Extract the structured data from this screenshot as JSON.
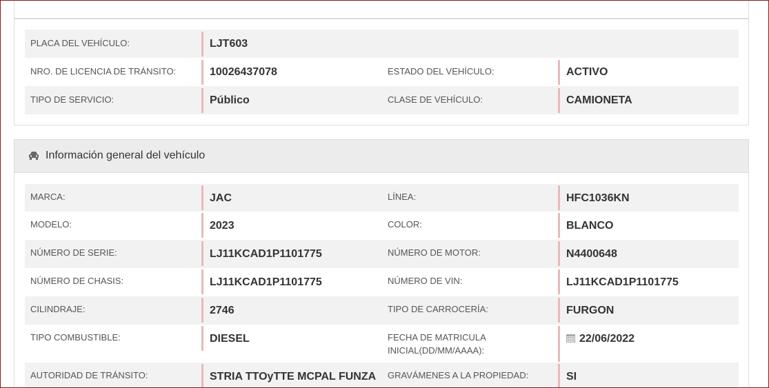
{
  "top_section": {
    "rows": [
      {
        "l1": "PLACA DEL VEHÍCULO:",
        "v1": "LJT603"
      },
      {
        "l1": "NRO. DE LICENCIA DE TRÁNSITO:",
        "v1": "10026437078",
        "l2": "ESTADO DEL VEHÍCULO:",
        "v2": "ACTIVO"
      },
      {
        "l1": "TIPO DE SERVICIO:",
        "v1": "Público",
        "l2": "CLASE DE VEHÍCULO:",
        "v2": "CAMIONETA"
      }
    ]
  },
  "general_section": {
    "title": "Información general del vehículo",
    "icon": "car-icon",
    "rows": [
      {
        "l1": "MARCA:",
        "v1": "JAC",
        "l2": "LÍNEA:",
        "v2": "HFC1036KN"
      },
      {
        "l1": "MODELO:",
        "v1": "2023",
        "l2": "COLOR:",
        "v2": "BLANCO"
      },
      {
        "l1": "NÚMERO DE SERIE:",
        "v1": "LJ11KCAD1P1101775",
        "l2": "NÚMERO DE MOTOR:",
        "v2": "N4400648"
      },
      {
        "l1": "NÚMERO DE CHASIS:",
        "v1": "LJ11KCAD1P1101775",
        "l2": "NÚMERO DE VIN:",
        "v2": "LJ11KCAD1P1101775"
      },
      {
        "l1": "CILINDRAJE:",
        "v1": "2746",
        "l2": "TIPO DE CARROCERÍA:",
        "v2": "FURGON"
      },
      {
        "l1": "TIPO COMBUSTIBLE:",
        "v1": "DIESEL",
        "l2": "FECHA DE MATRICULA INICIAL(DD/MM/AAAA):",
        "v2": "22/06/2022"
      },
      {
        "l1": "AUTORIDAD DE TRÁNSITO:",
        "v1": "STRIA TTOyTTE MCPAL FUNZA",
        "l2": "GRAVÁMENES A LA PROPIEDAD:",
        "v2": "SI"
      }
    ]
  },
  "colors": {
    "frame_border": "#8b1a1a",
    "value_accent": "#e8b9b9",
    "row_shade": "#f2f2f2",
    "header_bg": "#ececec"
  }
}
